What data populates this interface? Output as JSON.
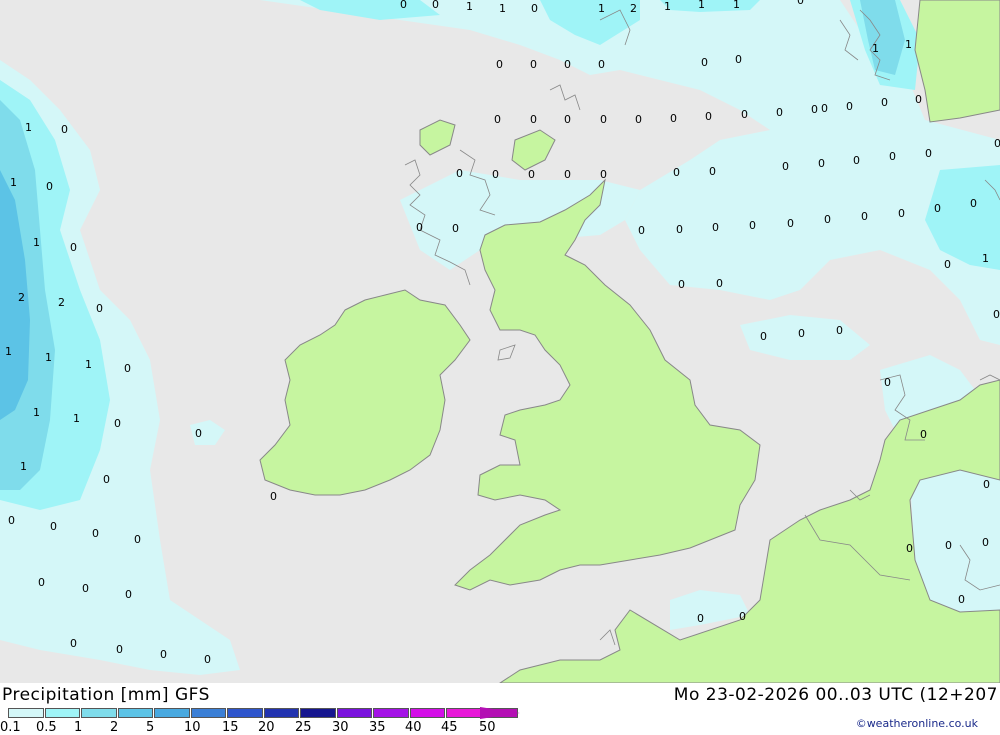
{
  "title": "Precipitation [mm] GFS",
  "run_time": "Mo 23-02-2026 00..03 UTC (12+207",
  "credit": "©weatheronline.co.uk",
  "colors": {
    "sea": "#e8e8e8",
    "land": "#c6f5a0",
    "precip_0_1": "#d4f7f8",
    "precip_0_5": "#9ff4f7",
    "precip_1": "#7fdceb",
    "precip_2": "#5cc3e6",
    "coast": "#888888"
  },
  "legend": {
    "labels": [
      "0.1",
      "0.5",
      "1",
      "2",
      "5",
      "10",
      "15",
      "20",
      "25",
      "30",
      "35",
      "40",
      "45",
      "50"
    ],
    "colors": [
      "#d4f7f8",
      "#9ff4f7",
      "#7fdceb",
      "#5cc3e6",
      "#49a9e0",
      "#3b7fd6",
      "#2e55cc",
      "#2233b0",
      "#16168f",
      "#7a12dd",
      "#a412e6",
      "#d40ee8",
      "#e818d8",
      "#b40fb4"
    ]
  },
  "grid_values": [
    "0",
    "0",
    "1",
    "1",
    "0",
    "1",
    "2",
    "1",
    "1",
    "1",
    "0",
    "0",
    "0",
    "0",
    "0",
    "0",
    "0",
    "1",
    "1",
    "0",
    "0",
    "0",
    "0",
    "0",
    "0",
    "0",
    "0",
    "0",
    "0",
    "0",
    "0",
    "0",
    "0",
    "0",
    "0",
    "0",
    "0",
    "0",
    "0",
    "1",
    "1",
    "1",
    "2",
    "1",
    "2",
    "1",
    "1",
    "1",
    "1",
    "1",
    "0",
    "0",
    "0",
    "0",
    "0",
    "0",
    "0",
    "0",
    "0",
    "0",
    "0",
    "0",
    "0",
    "0",
    "0",
    "0",
    "0",
    "0",
    "0",
    "0",
    "0",
    "0",
    "0",
    "0",
    "0",
    "0",
    "0",
    "0",
    "0",
    "0",
    "0",
    "0",
    "0",
    "1",
    "0",
    "0"
  ]
}
